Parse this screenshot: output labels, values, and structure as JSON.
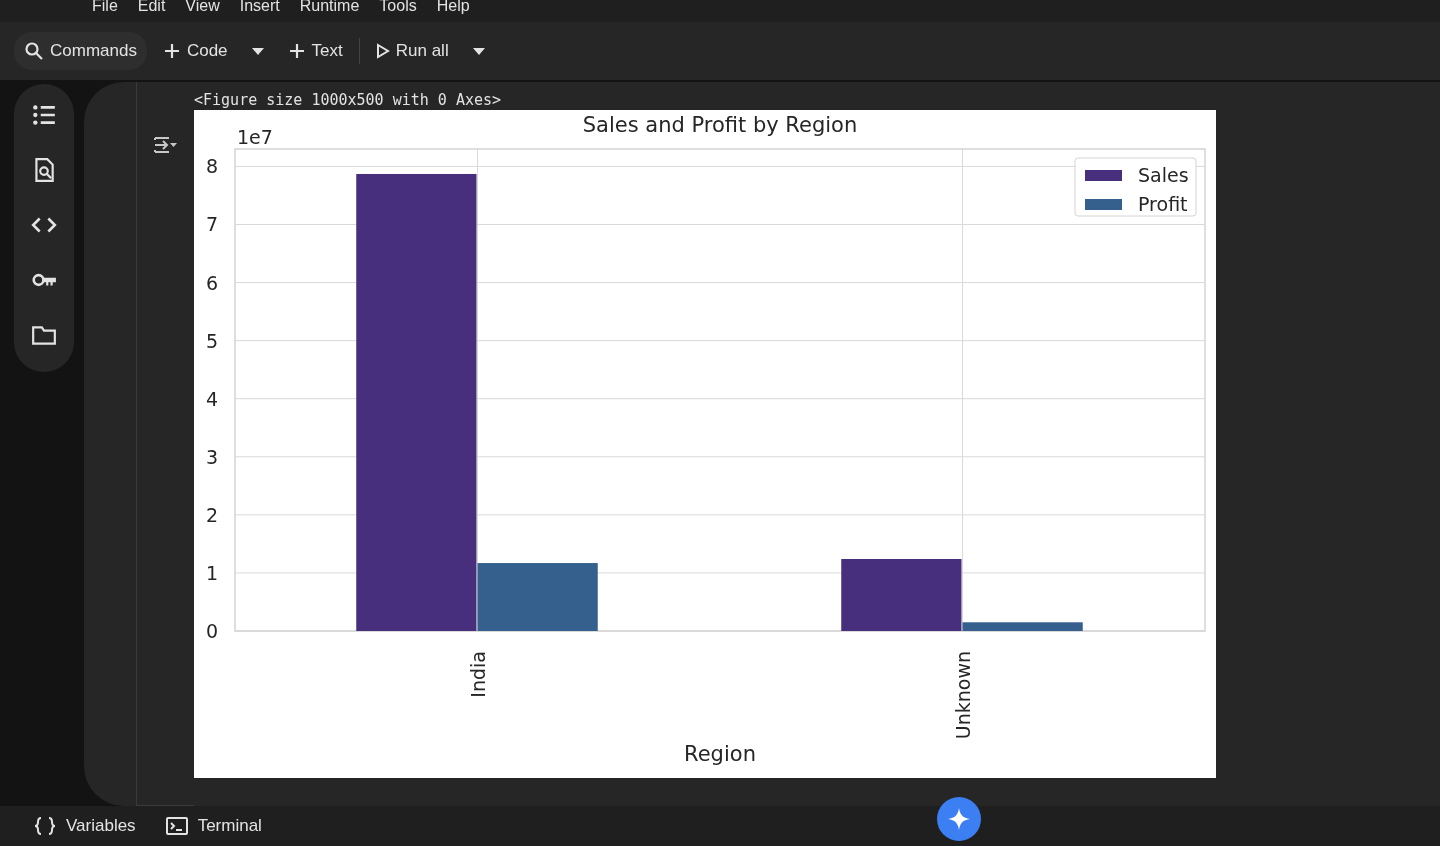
{
  "menu": [
    "File",
    "Edit",
    "View",
    "Insert",
    "Runtime",
    "Tools",
    "Help"
  ],
  "toolbar": [
    {
      "kind": "search",
      "label": "Commands"
    },
    {
      "kind": "add",
      "label": "Code",
      "dropdown": true
    },
    {
      "kind": "add",
      "label": "Text",
      "dropdown": false
    },
    {
      "kind": "run",
      "label": "Run all",
      "dropdown": true
    }
  ],
  "side_rail": [
    {
      "kind": "toc"
    },
    {
      "kind": "find"
    },
    {
      "kind": "snippets"
    },
    {
      "kind": "secrets"
    },
    {
      "kind": "files"
    }
  ],
  "cell": {
    "output_text": "<Figure size 1000x500 with 0 Axes>",
    "chart_data": {
      "type": "bar",
      "title": "Sales and Profit by Region",
      "xlabel": "Region",
      "categories": [
        "India",
        "Unknown"
      ],
      "ylim": [
        0,
        8.3
      ],
      "yticks": [
        0,
        1,
        2,
        3,
        4,
        5,
        6,
        7,
        8
      ],
      "annotations": [
        {
          "text": "1e7"
        }
      ],
      "grid": true,
      "legend": true,
      "series": [
        {
          "name": "Sales",
          "color": "#482f7d",
          "values": [
            7.87,
            1.24
          ]
        },
        {
          "name": "Profit",
          "color": "#355f8d",
          "values": [
            1.17,
            0.15
          ]
        }
      ]
    }
  },
  "status_bar": [
    {
      "kind": "variables",
      "label": "Variables"
    },
    {
      "kind": "terminal",
      "label": "Terminal"
    }
  ]
}
